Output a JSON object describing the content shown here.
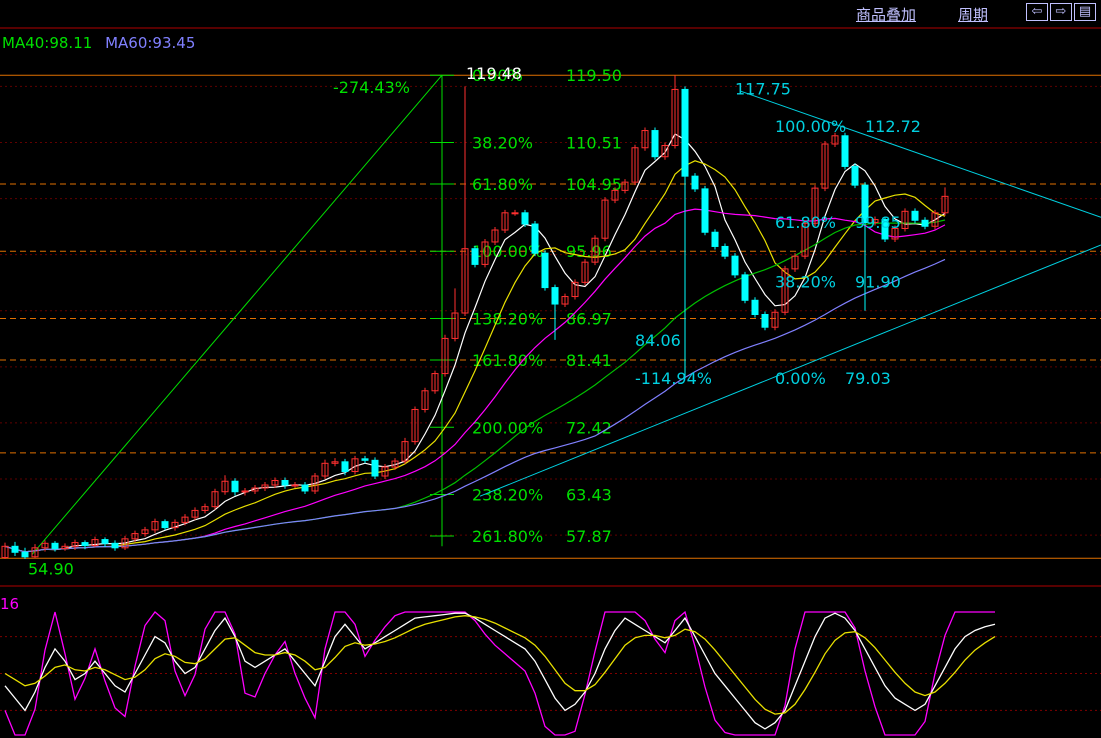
{
  "topbar": {
    "overlay_label": "商品叠加",
    "period_label": "周期",
    "nav_buttons": [
      "⇦",
      "⇨",
      "▤"
    ]
  },
  "legend": {
    "ma40": "MA40:98.11",
    "ma60": "MA60:93.45",
    "kdj": "16"
  },
  "colors": {
    "background": "#000000",
    "up_candle": "#ff3030",
    "down_candle": "#00ffff",
    "fib_text": "#00e000",
    "fib_line": "#e07000",
    "trendline": "#00d0e0",
    "ma5": "#ffffff",
    "ma10": "#e8e000",
    "ma20": "#ff00ff",
    "ma40": "#00c000",
    "ma60": "#8080ff"
  },
  "chart_data": {
    "type": "candlestick",
    "ylim": [
      54.0,
      121.0
    ],
    "x_count": 100,
    "fib_retracement": {
      "levels": [
        {
          "pct": "0.00%",
          "price": 119.5
        },
        {
          "pct": "38.20%",
          "price": 110.51
        },
        {
          "pct": "61.80%",
          "price": 104.95
        },
        {
          "pct": "100.00%",
          "price": 95.96
        },
        {
          "pct": "138.20%",
          "price": 86.97
        },
        {
          "pct": "161.80%",
          "price": 81.41
        },
        {
          "pct": "200.00%",
          "price": 72.42
        },
        {
          "pct": "238.20%",
          "price": 63.43
        },
        {
          "pct": "261.80%",
          "price": 57.87
        }
      ],
      "low_label": "54.90",
      "start_pct": "-274.43%",
      "high_label": "119.48"
    },
    "swing_annotations": [
      {
        "text": "117.75",
        "x": 73,
        "y": 117.75
      },
      {
        "text": "100.00%",
        "x": 77,
        "y": 112.72
      },
      {
        "text": "112.72",
        "x": 86,
        "y": 112.72
      },
      {
        "text": "61.80%",
        "x": 77,
        "y": 99.85
      },
      {
        "text": "99.85",
        "x": 85,
        "y": 99.85
      },
      {
        "text": "38.20%",
        "x": 77,
        "y": 91.9
      },
      {
        "text": "91.90",
        "x": 85,
        "y": 91.9
      },
      {
        "text": "84.06",
        "x": 63,
        "y": 84.06
      },
      {
        "text": "-114.94%",
        "x": 63,
        "y": 79.03
      },
      {
        "text": "0.00%",
        "x": 77,
        "y": 79.03
      },
      {
        "text": "79.03",
        "x": 84,
        "y": 79.03
      }
    ],
    "dashed_levels": [
      104.95,
      95.96,
      86.97,
      81.41,
      69.0
    ],
    "candles": [
      [
        55.0,
        56.5,
        54.8,
        57.0
      ],
      [
        56.5,
        55.7,
        55.2,
        57.1
      ],
      [
        55.7,
        55.1,
        54.8,
        56.3
      ],
      [
        55.1,
        56.3,
        54.9,
        56.8
      ],
      [
        56.3,
        56.9,
        55.8,
        57.3
      ],
      [
        56.9,
        56.2,
        55.8,
        57.2
      ],
      [
        56.2,
        56.5,
        55.9,
        56.9
      ],
      [
        56.5,
        57.0,
        56.0,
        57.4
      ],
      [
        57.0,
        56.6,
        56.1,
        57.3
      ],
      [
        56.6,
        57.4,
        56.4,
        57.8
      ],
      [
        57.4,
        56.9,
        56.4,
        57.7
      ],
      [
        56.9,
        56.3,
        55.9,
        57.3
      ],
      [
        56.3,
        57.5,
        56.0,
        57.9
      ],
      [
        57.5,
        58.2,
        57.1,
        58.6
      ],
      [
        58.2,
        58.7,
        57.8,
        59.1
      ],
      [
        58.7,
        59.8,
        58.3,
        60.2
      ],
      [
        59.8,
        59.0,
        58.7,
        60.1
      ],
      [
        59.0,
        59.7,
        58.6,
        60.1
      ],
      [
        59.7,
        60.4,
        59.3,
        60.8
      ],
      [
        60.4,
        61.3,
        60.0,
        61.7
      ],
      [
        61.3,
        61.8,
        60.9,
        62.2
      ],
      [
        61.8,
        63.8,
        61.4,
        64.2
      ],
      [
        63.8,
        65.2,
        63.4,
        66.0
      ],
      [
        65.2,
        63.8,
        63.3,
        65.6
      ],
      [
        63.8,
        63.9,
        63.3,
        64.3
      ],
      [
        63.9,
        64.3,
        63.5,
        64.7
      ],
      [
        64.3,
        64.7,
        63.9,
        65.1
      ],
      [
        64.7,
        65.3,
        64.3,
        65.7
      ],
      [
        65.3,
        64.7,
        64.2,
        65.7
      ],
      [
        64.7,
        64.7,
        64.3,
        65.1
      ],
      [
        64.7,
        63.9,
        63.5,
        65.1
      ],
      [
        63.9,
        65.9,
        63.5,
        66.3
      ],
      [
        65.9,
        67.6,
        65.5,
        68.1
      ],
      [
        67.6,
        67.8,
        67.2,
        68.3
      ],
      [
        67.8,
        66.5,
        66.0,
        68.2
      ],
      [
        66.5,
        68.2,
        66.1,
        68.6
      ],
      [
        68.2,
        68.0,
        67.6,
        68.6
      ],
      [
        68.0,
        65.9,
        65.5,
        68.4
      ],
      [
        65.9,
        67.1,
        65.5,
        67.5
      ],
      [
        67.1,
        67.9,
        66.7,
        68.3
      ],
      [
        67.9,
        70.5,
        67.5,
        71.0
      ],
      [
        70.5,
        74.8,
        70.1,
        75.2
      ],
      [
        74.8,
        77.3,
        74.4,
        77.7
      ],
      [
        77.3,
        79.6,
        76.9,
        80.0
      ],
      [
        79.6,
        84.3,
        79.2,
        84.8
      ],
      [
        84.3,
        87.7,
        83.9,
        91.0
      ],
      [
        87.7,
        96.3,
        87.3,
        118.0
      ],
      [
        96.3,
        94.2,
        93.8,
        96.7
      ],
      [
        94.2,
        97.2,
        93.8,
        97.6
      ],
      [
        97.2,
        98.8,
        96.8,
        99.2
      ],
      [
        98.8,
        101.1,
        98.4,
        101.5
      ],
      [
        101.1,
        101.1,
        100.7,
        101.5
      ],
      [
        101.1,
        99.6,
        99.2,
        101.5
      ],
      [
        99.6,
        95.7,
        95.3,
        100.0
      ],
      [
        95.7,
        91.1,
        90.7,
        96.1
      ],
      [
        91.1,
        88.9,
        84.1,
        91.5
      ],
      [
        88.9,
        89.9,
        88.5,
        90.3
      ],
      [
        89.9,
        91.8,
        89.5,
        92.2
      ],
      [
        91.8,
        94.5,
        91.4,
        94.9
      ],
      [
        94.5,
        97.7,
        94.1,
        98.1
      ],
      [
        97.7,
        102.8,
        97.3,
        103.2
      ],
      [
        102.8,
        104.1,
        102.4,
        104.5
      ],
      [
        104.1,
        105.2,
        103.7,
        105.6
      ],
      [
        105.2,
        109.8,
        104.8,
        110.2
      ],
      [
        109.8,
        112.1,
        109.4,
        112.5
      ],
      [
        112.1,
        108.6,
        108.2,
        112.5
      ],
      [
        108.6,
        110.1,
        108.2,
        110.5
      ],
      [
        110.1,
        117.6,
        109.7,
        119.5
      ],
      [
        117.6,
        106.0,
        79.0,
        118.0
      ],
      [
        106.0,
        104.3,
        103.9,
        106.4
      ],
      [
        104.3,
        98.5,
        98.1,
        104.7
      ],
      [
        98.5,
        96.6,
        96.2,
        98.9
      ],
      [
        96.6,
        95.3,
        94.9,
        97.0
      ],
      [
        95.3,
        92.8,
        92.4,
        95.7
      ],
      [
        92.8,
        89.4,
        89.0,
        93.2
      ],
      [
        89.4,
        87.5,
        87.1,
        89.8
      ],
      [
        87.5,
        85.8,
        85.4,
        87.9
      ],
      [
        85.8,
        87.8,
        85.4,
        88.2
      ],
      [
        87.8,
        93.6,
        87.4,
        94.0
      ],
      [
        93.6,
        95.3,
        93.2,
        95.7
      ],
      [
        95.3,
        99.7,
        94.9,
        100.1
      ],
      [
        99.7,
        104.4,
        99.3,
        104.8
      ],
      [
        104.4,
        110.3,
        104.0,
        110.7
      ],
      [
        110.3,
        111.4,
        109.9,
        111.8
      ],
      [
        111.4,
        107.3,
        106.9,
        111.8
      ],
      [
        107.3,
        104.8,
        104.4,
        107.7
      ],
      [
        104.8,
        99.8,
        88.0,
        105.2
      ],
      [
        99.8,
        100.2,
        99.4,
        100.6
      ],
      [
        100.2,
        97.6,
        97.2,
        100.6
      ],
      [
        97.6,
        99.0,
        97.2,
        99.4
      ],
      [
        99.0,
        101.3,
        98.6,
        101.7
      ],
      [
        101.3,
        100.1,
        99.7,
        101.7
      ],
      [
        100.1,
        99.3,
        98.9,
        100.5
      ],
      [
        99.3,
        101.1,
        98.9,
        101.5
      ],
      [
        101.1,
        103.3,
        100.7,
        104.5
      ]
    ],
    "indicator": {
      "name": "KDJ",
      "period_label": "16",
      "ylim": [
        0,
        100
      ],
      "K": [
        40,
        30,
        20,
        35,
        55,
        70,
        60,
        45,
        50,
        60,
        50,
        40,
        35,
        50,
        65,
        80,
        75,
        60,
        50,
        55,
        70,
        85,
        95,
        80,
        60,
        55,
        60,
        65,
        70,
        60,
        50,
        40,
        60,
        80,
        90,
        80,
        70,
        75,
        80,
        85,
        90,
        95,
        96,
        97,
        98,
        99,
        99,
        95,
        90,
        85,
        80,
        75,
        70,
        60,
        45,
        30,
        20,
        25,
        35,
        50,
        70,
        85,
        95,
        90,
        85,
        80,
        75,
        85,
        95,
        80,
        65,
        50,
        40,
        30,
        20,
        10,
        5,
        10,
        20,
        40,
        60,
        80,
        95,
        99,
        95,
        85,
        70,
        55,
        40,
        30,
        25,
        20,
        25,
        40,
        55,
        70,
        80,
        85,
        88,
        90
      ],
      "D": [
        50,
        45,
        40,
        42,
        48,
        55,
        57,
        53,
        52,
        55,
        53,
        49,
        45,
        47,
        53,
        62,
        66,
        64,
        59,
        58,
        62,
        70,
        78,
        79,
        73,
        67,
        65,
        65,
        67,
        65,
        60,
        53,
        55,
        63,
        72,
        75,
        73,
        74,
        76,
        79,
        83,
        87,
        90,
        92,
        94,
        96,
        97,
        96,
        94,
        91,
        87,
        83,
        79,
        73,
        64,
        53,
        42,
        36,
        36,
        41,
        51,
        62,
        73,
        79,
        81,
        81,
        79,
        81,
        86,
        84,
        78,
        69,
        59,
        49,
        39,
        29,
        21,
        17,
        18,
        25,
        37,
        51,
        66,
        77,
        83,
        84,
        79,
        71,
        61,
        51,
        42,
        35,
        32,
        35,
        42,
        51,
        61,
        69,
        75,
        80
      ]
    }
  }
}
